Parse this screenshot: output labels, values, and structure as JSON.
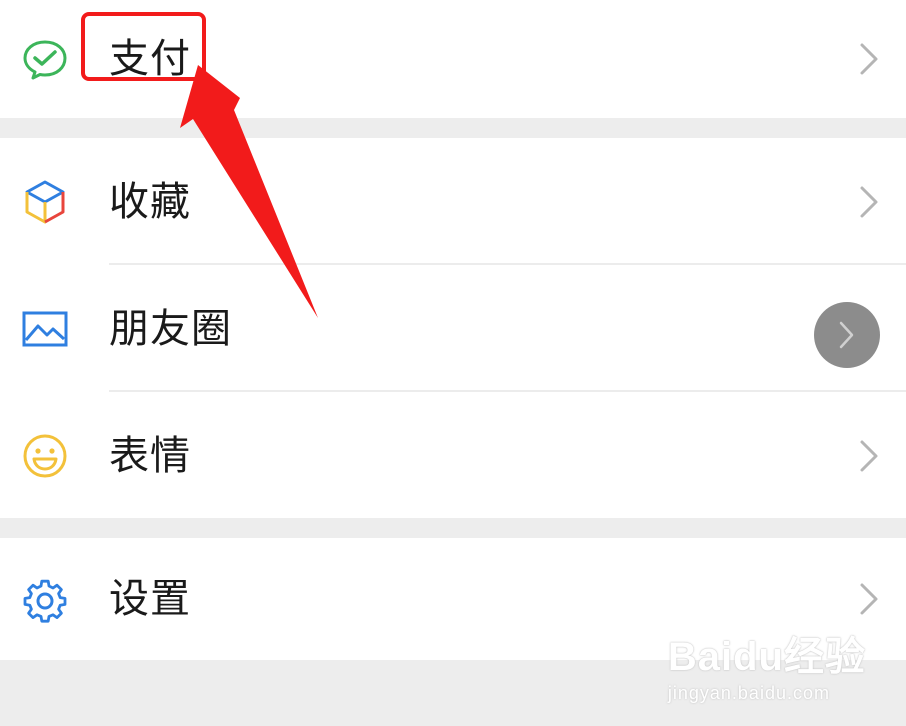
{
  "menu": {
    "pay": {
      "label": "支付",
      "icon": "wechat-pay-icon"
    },
    "favorites": {
      "label": "收藏",
      "icon": "cube-icon"
    },
    "moments": {
      "label": "朋友圈",
      "icon": "picture-icon"
    },
    "stickers": {
      "label": "表情",
      "icon": "smiley-icon"
    },
    "settings": {
      "label": "设置",
      "icon": "gear-icon"
    }
  },
  "colors": {
    "background": "#ededed",
    "row_background": "#ffffff",
    "annotation_red": "#f21b1b",
    "pay_green": "#3cb55a",
    "settings_blue": "#2f7fe0",
    "stickers_yellow": "#f3c13a"
  },
  "watermark": {
    "brand": "Baidu经验",
    "url": "jingyan.baidu.com"
  }
}
